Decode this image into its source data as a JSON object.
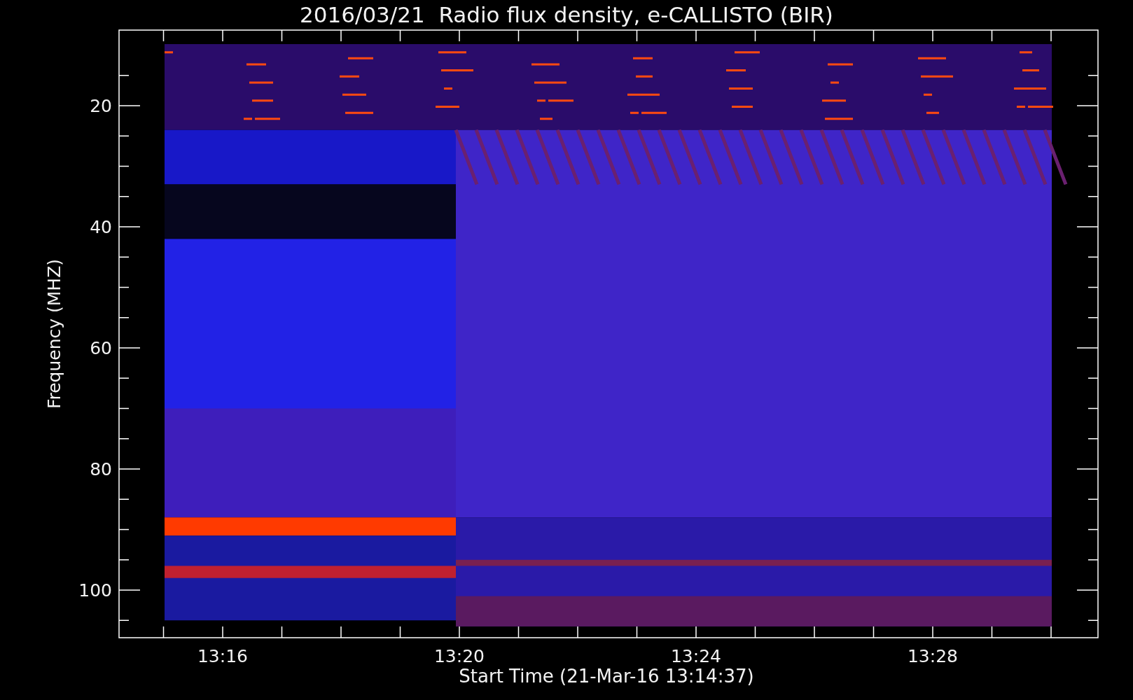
{
  "title": "2016/03/21  Radio flux density, e-CALLISTO (BIR)",
  "y_axis": {
    "label": "Frequency (MHZ)",
    "ticks": [
      "20",
      "40",
      "60",
      "80",
      "100"
    ]
  },
  "x_axis": {
    "label": "Start Time (21-Mar-16 13:14:37)",
    "ticks": [
      "13:16",
      "13:20",
      "13:24",
      "13:28"
    ]
  }
}
